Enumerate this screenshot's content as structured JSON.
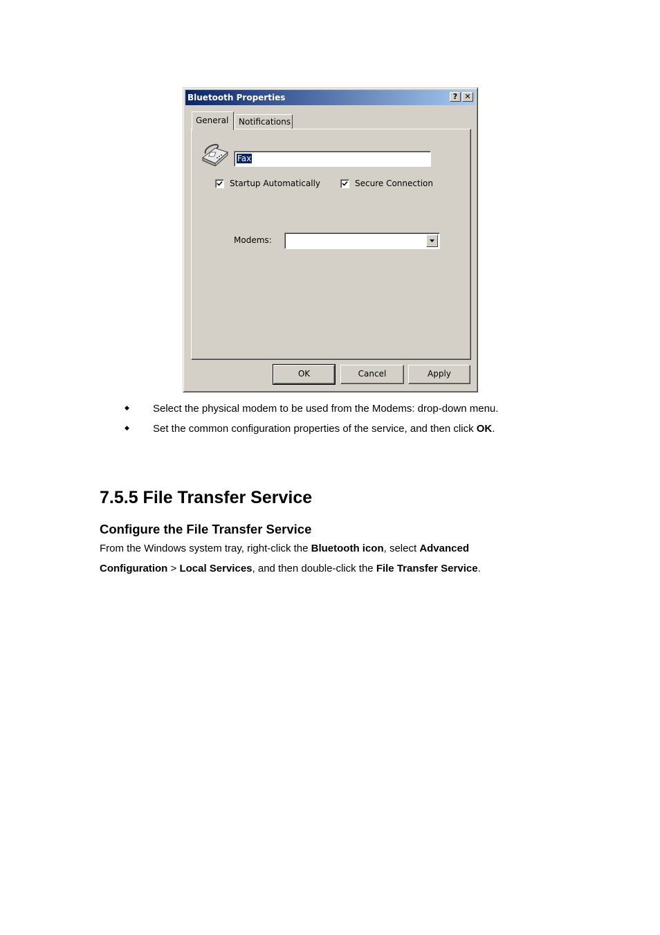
{
  "dialog": {
    "title": "Bluetooth Properties",
    "help_label": "?",
    "close_label": "✕",
    "tabs": [
      {
        "label": "General",
        "active": true
      },
      {
        "label": "Notifications",
        "active": false
      }
    ],
    "name_field_value": "Fax",
    "checkboxes": [
      {
        "label": "Startup Automatically",
        "checked": true
      },
      {
        "label": "Secure Connection",
        "checked": true
      }
    ],
    "modems_label": "Modems:",
    "modems_value": "",
    "buttons": {
      "ok": "OK",
      "cancel": "Cancel",
      "apply": "Apply"
    },
    "icon": "fax-machine-icon"
  },
  "bullets": [
    {
      "text": "Select the physical modem to be used from the Modems: drop-down menu."
    },
    {
      "text_before": "Set the common configuration properties of the service, and then click ",
      "bold": "OK",
      "text_after": "."
    }
  ],
  "section_heading": "7.5.5 File Transfer Service",
  "subheading": "Configure the File Transfer Service",
  "paragraph": {
    "line1": {
      "t1": "From the Windows system tray, right-click the ",
      "b1": "Bluetooth icon",
      "t2": ", select ",
      "b2": "Advanced"
    },
    "line2": {
      "b1": "Configuration",
      "t1": " > ",
      "b2": "Local Services",
      "t2": ", and then double-click the ",
      "b3": "File Transfer Service",
      "t3": "."
    }
  }
}
